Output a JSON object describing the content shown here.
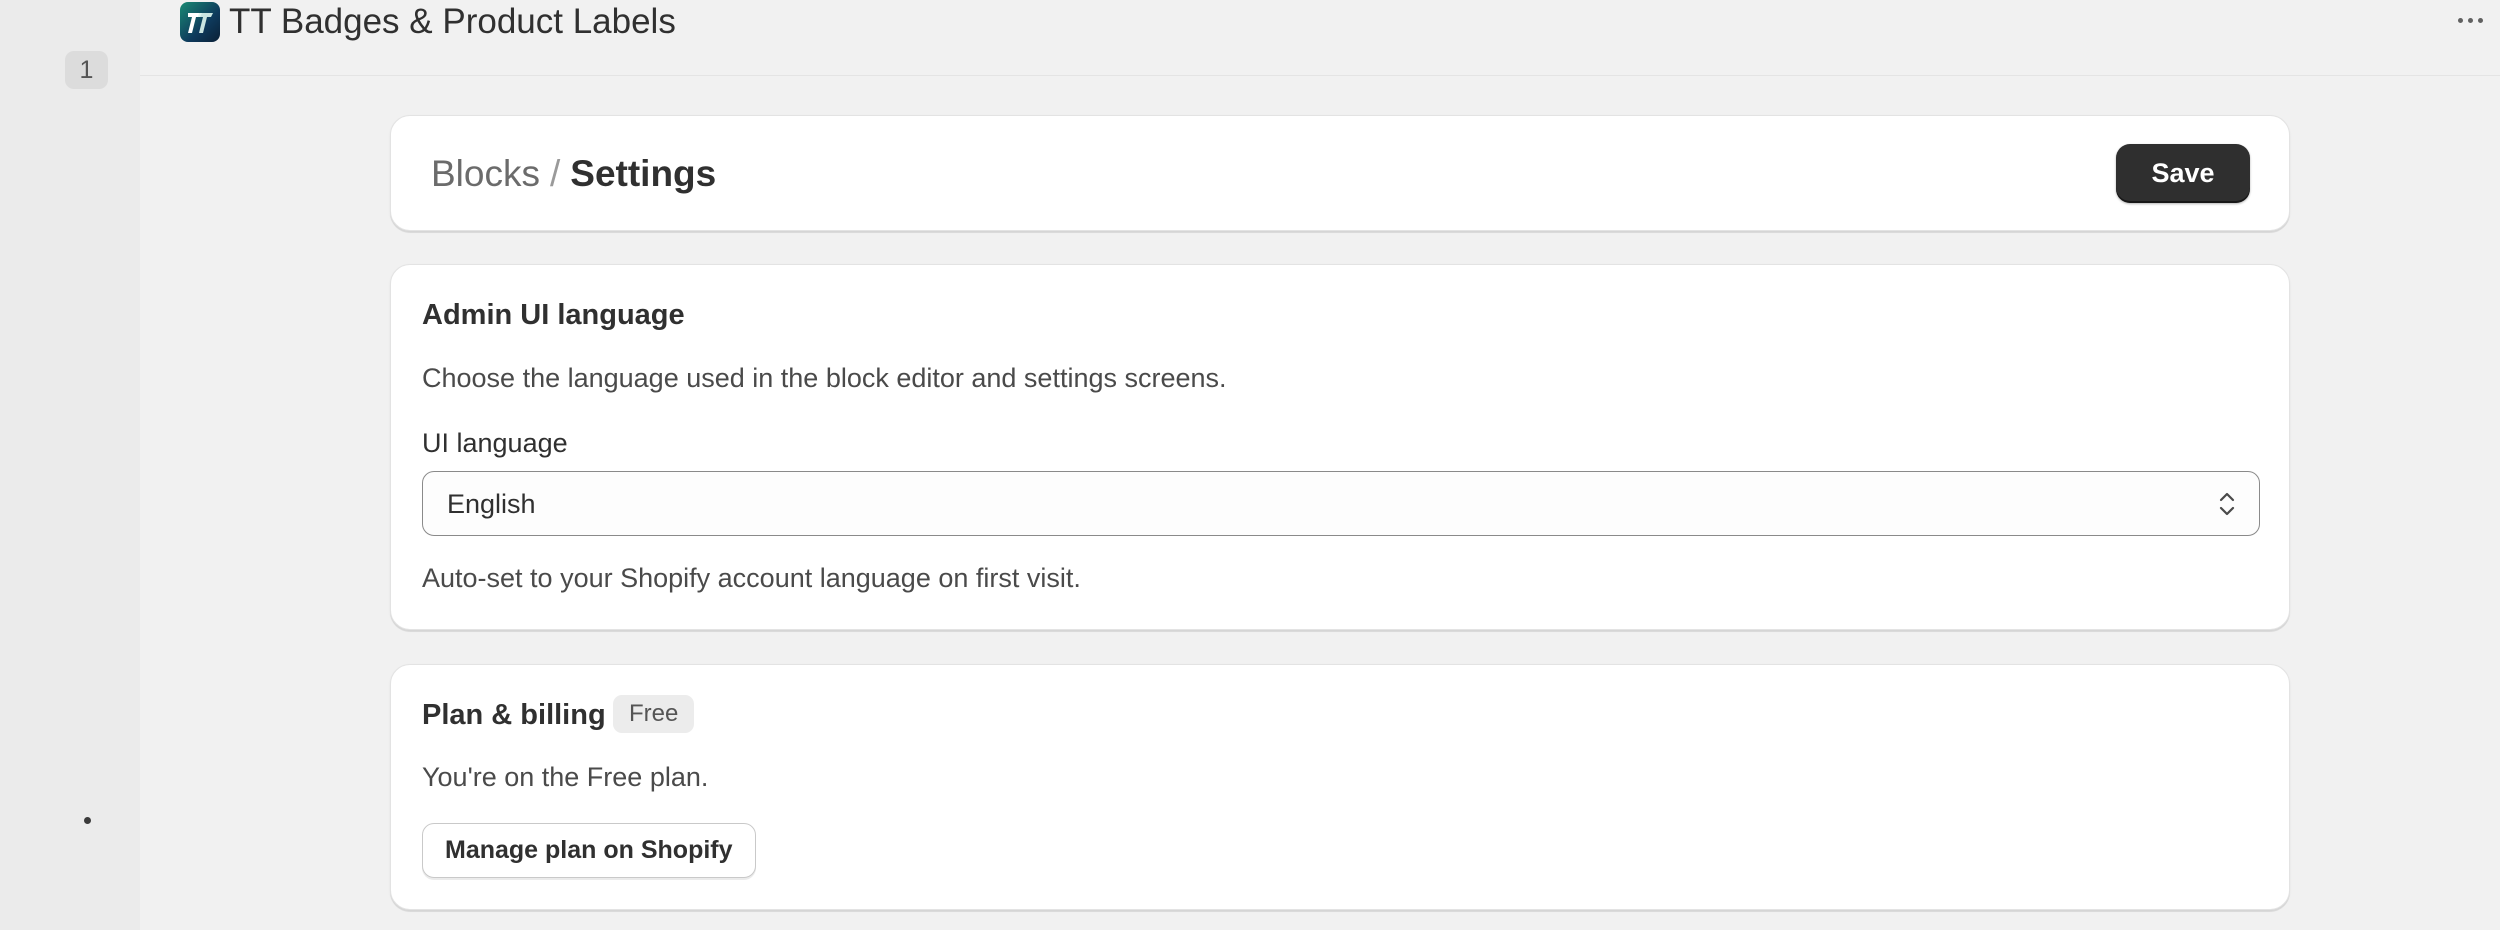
{
  "app": {
    "title": "TT Badges & Product Labels",
    "logo_icon": "tt-app-logo-icon",
    "logo_text": "TT"
  },
  "rail": {
    "badge": "1"
  },
  "header": {
    "breadcrumb_parent": "Blocks",
    "breadcrumb_separator": "/",
    "breadcrumb_current": "Settings",
    "save_label": "Save"
  },
  "language_section": {
    "title": "Admin UI language",
    "description": "Choose the language used in the block editor and settings screens.",
    "field_label": "UI language",
    "selected_value": "English",
    "help_text": "Auto-set to your Shopify account language on first visit."
  },
  "billing_section": {
    "title": "Plan & billing",
    "badge": "Free",
    "description": "You're on the Free plan.",
    "button_label": "Manage plan on Shopify"
  },
  "colors": {
    "primary_button": "#2f2f2f",
    "page_background": "#f1f1f1",
    "card_background": "#ffffff"
  }
}
